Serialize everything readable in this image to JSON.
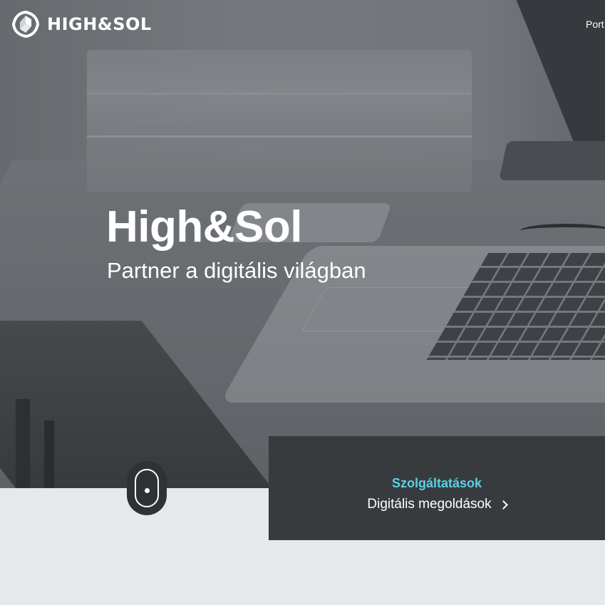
{
  "header": {
    "logo_text": "HIGH&SOL",
    "nav_partial": "Port"
  },
  "hero": {
    "title": "High&Sol",
    "subtitle": "Partner a digitális világban"
  },
  "services_card": {
    "title": "Szolgáltatások",
    "link_label": "Digitális megoldások",
    "title_color": "#5ad0e6",
    "background_color": "#383b3e"
  },
  "icons": {
    "logo": "high-sol-logo-icon",
    "scroll": "scroll-mouse-icon",
    "link_arrow": "chevron-right-icon"
  }
}
